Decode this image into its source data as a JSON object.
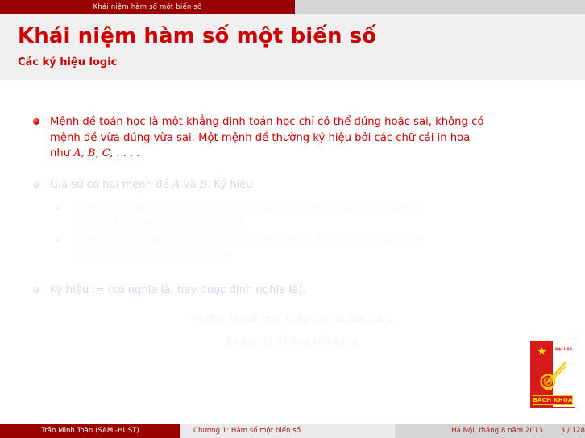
{
  "navbar": {
    "active_section": "Khái niệm hàm số một biến số"
  },
  "slide": {
    "title": "Khái niệm hàm số một biến số",
    "subtitle": "Các ký hiệu logic"
  },
  "content": {
    "items": [
      {
        "state": "active",
        "text_lines": [
          "Mệnh đề toán học là một khẳng định toán học chỉ có thể đúng hoặc sai, không có",
          "mệnh đề vừa đúng vừa sai. Một mệnh đề thường ký hiệu bởi các chữ cái in hoa",
          "như A, B, C, . . . ."
        ],
        "line3_prefix": "như ",
        "line3_math": "A, B, C, . . . ."
      },
      {
        "state": "dim",
        "prefix": "Giả sử có hai mệnh đề ",
        "math_a": "A",
        "mid": " và ",
        "math_b": "B",
        "suffix": ". Ký hiệu"
      }
    ],
    "subitems": [
      {
        "state": "dim2",
        "math": "A ⟹ B",
        "line1": ": từ mệnh đề A suy ra mệnh đề B, hay B là điều kiện cần để",
        "line2": "có A và A là điều kiện đủ để có B."
      },
      {
        "state": "dim2",
        "math": "A ⟺ B",
        "line1": ": mệnh đề A tương đương với mệnh đề B, hay A là điều kiện",
        "line2": "cần và đủ để có B và ngược lại."
      }
    ],
    "item3": {
      "state": "dim",
      "text": "Ký hiệu := (có nghĩa là, hay được định nghĩa là)."
    },
    "math_lines": [
      "∀x đọc là với mọi x,    ∃y đọc là tồn tại y,",
      "∄y đọc là không tồn tại y."
    ]
  },
  "logo": {
    "university_label": "ĐẠI HỌC",
    "banner_label": "BÁCH KHOA",
    "star_icon": "star-icon",
    "compass_icon": "compass-icon"
  },
  "footer": {
    "author": "Trần Minh Toàn (SAMI-HUST)",
    "chapter": "Chương 1: Hàm số một biến số",
    "place_date": "Hà Nội, tháng 8 năm 2013",
    "page": "3 / 128"
  },
  "colors": {
    "dark_red": "#990000",
    "bright_red": "#cc0000",
    "nav_grey": "#d5d5d5",
    "title_bg": "#f0f0f0",
    "dim_blue": "#d6d8ea"
  }
}
